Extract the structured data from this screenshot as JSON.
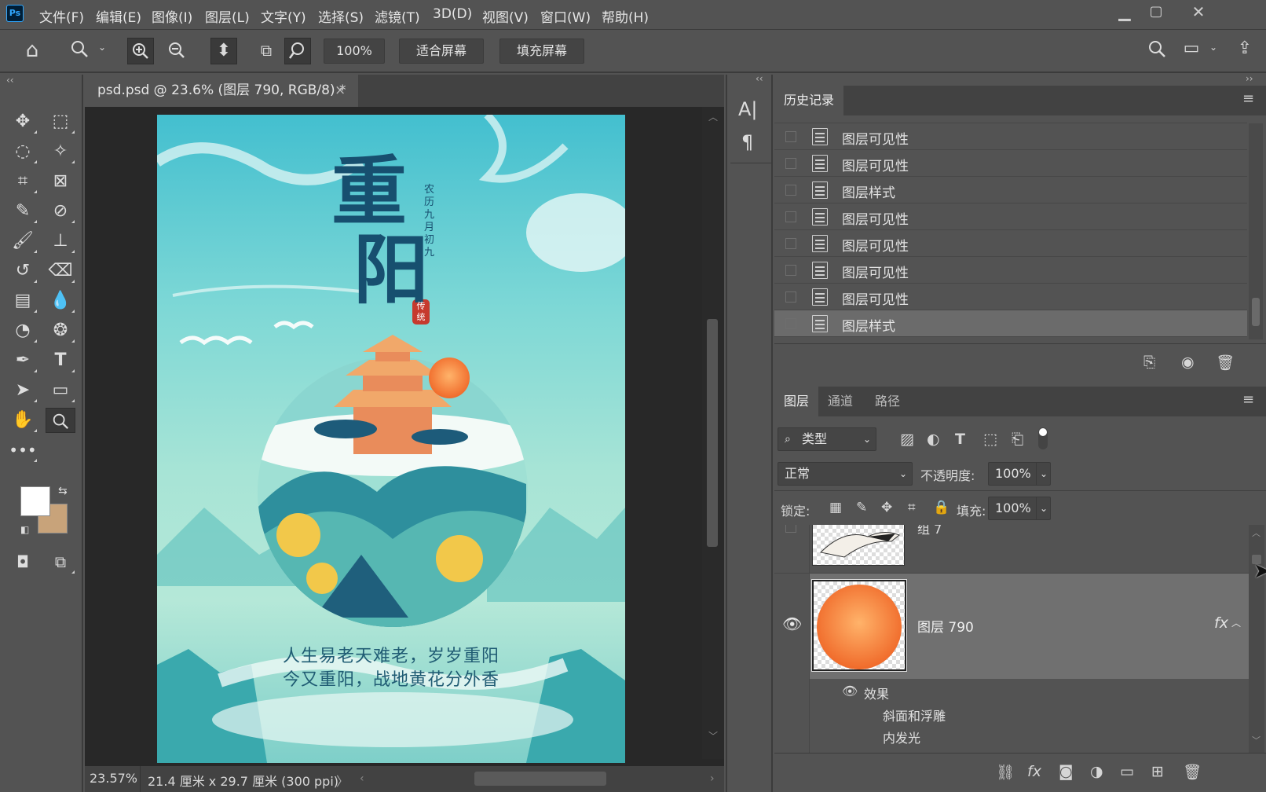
{
  "app": {
    "logo": "Ps",
    "menu": [
      "文件(F)",
      "编辑(E)",
      "图像(I)",
      "图层(L)",
      "文字(Y)",
      "选择(S)",
      "滤镜(T)",
      "3D(D)",
      "视图(V)",
      "窗口(W)",
      "帮助(H)"
    ]
  },
  "options": {
    "zoom_value": "100%",
    "fit_screen": "适合屏幕",
    "fill_screen": "填充屏幕"
  },
  "document": {
    "tab_title": "psd.psd @ 23.6% (图层 790, RGB/8) *",
    "close": "×",
    "zoom_status": "23.57%",
    "size_status": "21.4 厘米 x 29.7 厘米 (300 ppi)",
    "status_arrow": "〉"
  },
  "poster": {
    "title_big_1": "重",
    "title_big_2": "阳",
    "side_text": "农历九月初九",
    "seal": "传统",
    "line1": "人生易老天难老，岁岁重阳",
    "line2": "今又重阳，战地黄花分外香"
  },
  "swatches": {
    "foreground": "#ffffff",
    "background": "#c8a37a"
  },
  "history": {
    "tab": "历史记录",
    "items": [
      "图层可见性",
      "图层可见性",
      "图层样式",
      "图层可见性",
      "图层可见性",
      "图层可见性",
      "图层可见性",
      "图层样式"
    ]
  },
  "layers": {
    "tabs": [
      "图层",
      "通道",
      "路径"
    ],
    "filter_kind": "类型",
    "blend_mode": "正常",
    "opacity_label": "不透明度:",
    "opacity_value": "100%",
    "lock_label": "锁定:",
    "fill_label": "填充:",
    "fill_value": "100%",
    "group_name": "组 7",
    "layer_name": "图层 790",
    "fx": "fx",
    "effects_label": "效果",
    "effects": [
      "斜面和浮雕",
      "内发光"
    ]
  }
}
